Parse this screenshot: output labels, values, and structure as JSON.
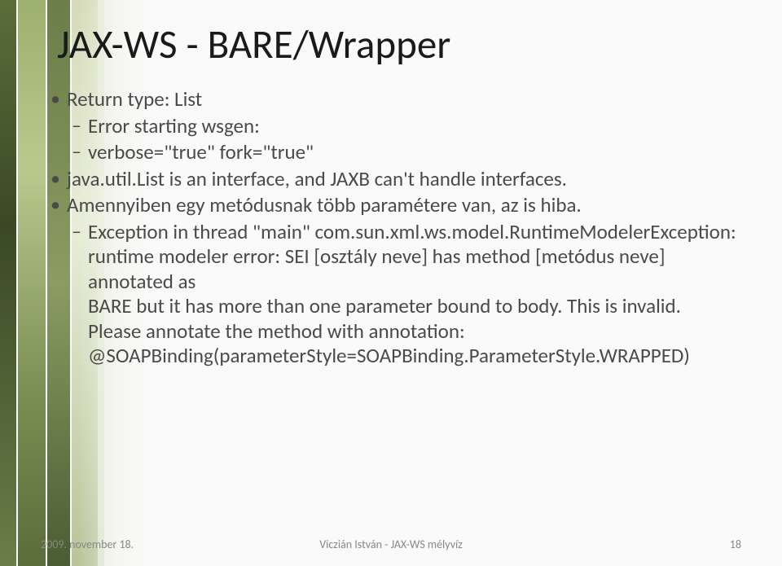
{
  "title": "JAX-WS - BARE/Wrapper",
  "bullets": {
    "b1": "Return type: List",
    "b1_1": "Error starting wsgen:",
    "b1_2": "verbose=\"true\" fork=\"true\"",
    "b2": "java.util.List is an interface, and JAXB can't handle interfaces.",
    "b3": "Amennyiben egy metódusnak több paramétere van, az is hiba.",
    "b3_1": "Exception in thread \"main\" com.sun.xml.ws.model.RuntimeModelerException: runtime modeler error: SEI [osztály neve] has method [metódus neve] annotated as",
    "b3_1b": "BARE but it has more than one parameter bound to body. This is invalid.",
    "b3_1c": "Please annotate the method with annotation: @SOAPBinding(parameterStyle=SOAPBinding.ParameterStyle.WRAPPED)"
  },
  "footer": {
    "date": "2009. november 18.",
    "center": "Viczián István - JAX-WS mélyvíz",
    "page": "18"
  }
}
